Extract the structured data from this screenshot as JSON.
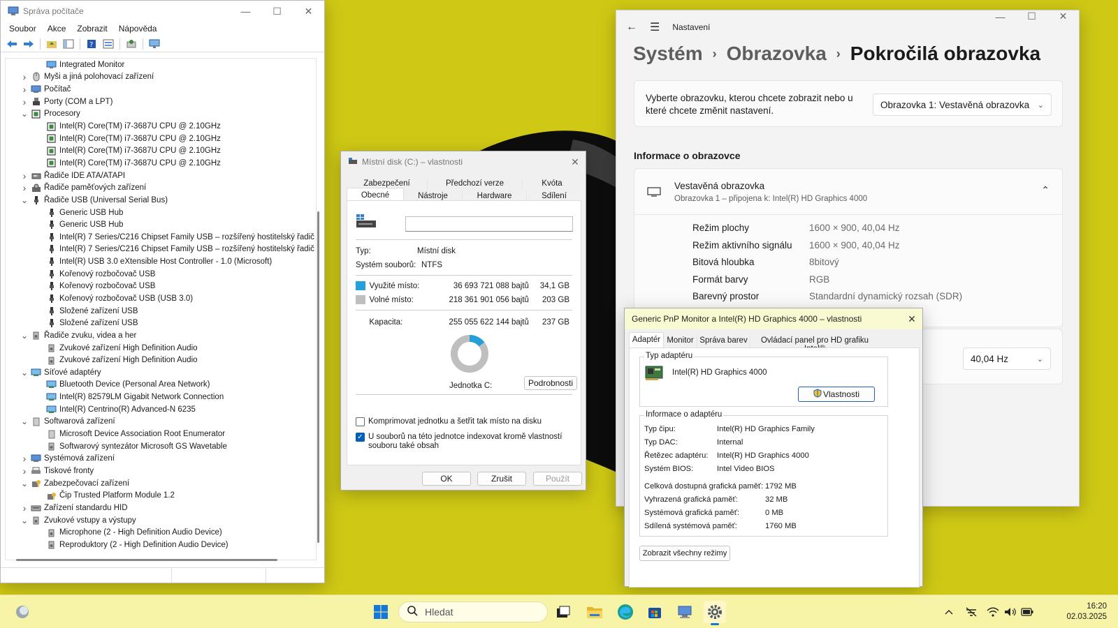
{
  "device_manager": {
    "title": "Správa počítače",
    "menu": [
      "Soubor",
      "Akce",
      "Zobrazit",
      "Nápověda"
    ],
    "tree": [
      {
        "label": "Integrated Monitor",
        "level": 2,
        "expander": "",
        "icon": "monitor-icon"
      },
      {
        "label": "Myši a jiná polohovací zařízení",
        "level": 1,
        "expander": "›",
        "icon": "mouse-icon"
      },
      {
        "label": "Počítač",
        "level": 1,
        "expander": "›",
        "icon": "computer-icon"
      },
      {
        "label": "Porty (COM a LPT)",
        "level": 1,
        "expander": "›",
        "icon": "port-icon"
      },
      {
        "label": "Procesory",
        "level": 1,
        "expander": "⌄",
        "icon": "processor-icon"
      },
      {
        "label": "Intel(R) Core(TM) i7-3687U CPU @ 2.10GHz",
        "level": 2,
        "expander": "",
        "icon": "processor-icon"
      },
      {
        "label": "Intel(R) Core(TM) i7-3687U CPU @ 2.10GHz",
        "level": 2,
        "expander": "",
        "icon": "processor-icon"
      },
      {
        "label": "Intel(R) Core(TM) i7-3687U CPU @ 2.10GHz",
        "level": 2,
        "expander": "",
        "icon": "processor-icon"
      },
      {
        "label": "Intel(R) Core(TM) i7-3687U CPU @ 2.10GHz",
        "level": 2,
        "expander": "",
        "icon": "processor-icon"
      },
      {
        "label": "Řadiče IDE ATA/ATAPI",
        "level": 1,
        "expander": "›",
        "icon": "disk-controller-icon"
      },
      {
        "label": "Řadiče paměťových zařízení",
        "level": 1,
        "expander": "›",
        "icon": "storage-controller-icon"
      },
      {
        "label": "Řadiče USB (Universal Serial Bus)",
        "level": 1,
        "expander": "⌄",
        "icon": "usb-icon"
      },
      {
        "label": "Generic USB Hub",
        "level": 2,
        "expander": "",
        "icon": "usb-icon"
      },
      {
        "label": "Generic USB Hub",
        "level": 2,
        "expander": "",
        "icon": "usb-icon"
      },
      {
        "label": "Intel(R) 7 Series/C216 Chipset Family USB – rozšířený hostitelský řadič",
        "level": 2,
        "expander": "",
        "icon": "usb-icon"
      },
      {
        "label": "Intel(R) 7 Series/C216 Chipset Family USB – rozšířený hostitelský řadič",
        "level": 2,
        "expander": "",
        "icon": "usb-icon"
      },
      {
        "label": "Intel(R) USB 3.0 eXtensible Host Controller - 1.0 (Microsoft)",
        "level": 2,
        "expander": "",
        "icon": "usb-icon"
      },
      {
        "label": "Kořenový rozbočovač USB",
        "level": 2,
        "expander": "",
        "icon": "usb-icon"
      },
      {
        "label": "Kořenový rozbočovač USB",
        "level": 2,
        "expander": "",
        "icon": "usb-icon"
      },
      {
        "label": "Kořenový rozbočovač USB (USB 3.0)",
        "level": 2,
        "expander": "",
        "icon": "usb-icon"
      },
      {
        "label": "Složené zařízení USB",
        "level": 2,
        "expander": "",
        "icon": "usb-icon"
      },
      {
        "label": "Složené zařízení USB",
        "level": 2,
        "expander": "",
        "icon": "usb-icon"
      },
      {
        "label": "Řadiče zvuku, videa a her",
        "level": 1,
        "expander": "⌄",
        "icon": "speaker-icon"
      },
      {
        "label": "Zvukové zařízení High Definition Audio",
        "level": 2,
        "expander": "",
        "icon": "speaker-icon"
      },
      {
        "label": "Zvukové zařízení High Definition Audio",
        "level": 2,
        "expander": "",
        "icon": "speaker-icon"
      },
      {
        "label": "Síťové adaptéry",
        "level": 1,
        "expander": "⌄",
        "icon": "network-icon"
      },
      {
        "label": "Bluetooth Device (Personal Area Network)",
        "level": 2,
        "expander": "",
        "icon": "network-icon"
      },
      {
        "label": "Intel(R) 82579LM Gigabit Network Connection",
        "level": 2,
        "expander": "",
        "icon": "network-icon"
      },
      {
        "label": "Intel(R) Centrino(R) Advanced-N 6235",
        "level": 2,
        "expander": "",
        "icon": "network-icon"
      },
      {
        "label": "Softwarová zařízení",
        "level": 1,
        "expander": "⌄",
        "icon": "software-device-icon"
      },
      {
        "label": "Microsoft Device Association Root Enumerator",
        "level": 2,
        "expander": "",
        "icon": "software-device-icon"
      },
      {
        "label": "Softwarový syntezátor Microsoft GS Wavetable",
        "level": 2,
        "expander": "",
        "icon": "speaker-icon"
      },
      {
        "label": "Systémová zařízení",
        "level": 1,
        "expander": "›",
        "icon": "system-device-icon"
      },
      {
        "label": "Tiskové fronty",
        "level": 1,
        "expander": "›",
        "icon": "printer-icon"
      },
      {
        "label": "Zabezpečovací zařízení",
        "level": 1,
        "expander": "⌄",
        "icon": "security-device-icon"
      },
      {
        "label": "Čip Trusted Platform Module 1.2",
        "level": 2,
        "expander": "",
        "icon": "security-device-icon"
      },
      {
        "label": "Zařízení standardu HID",
        "level": 1,
        "expander": "›",
        "icon": "hid-icon"
      },
      {
        "label": "Zvukové vstupy a výstupy",
        "level": 1,
        "expander": "⌄",
        "icon": "speaker-icon"
      },
      {
        "label": "Microphone (2 - High Definition Audio Device)",
        "level": 2,
        "expander": "",
        "icon": "speaker-icon"
      },
      {
        "label": "Reproduktory (2 - High Definition Audio Device)",
        "level": 2,
        "expander": "",
        "icon": "speaker-icon"
      }
    ]
  },
  "settings": {
    "app_name": "Nastavení",
    "breadcrumb": [
      "Systém",
      "Obrazovka",
      "Pokročilá obrazovka"
    ],
    "select_prompt": "Vyberte obrazovku, kterou chcete zobrazit nebo u které chcete změnit nastavení.",
    "display_dropdown": "Obrazovka 1: Vestavěná obrazovka",
    "section_title": "Informace o obrazovce",
    "display_name": "Vestavěná obrazovka",
    "display_subtitle": "Obrazovka 1 – připojena k: Intel(R) HD Graphics 4000",
    "info": [
      {
        "key": "Režim plochy",
        "value": "1600 × 900, 40,04 Hz"
      },
      {
        "key": "Režim aktivního signálu",
        "value": "1600 × 900, 40,04 Hz"
      },
      {
        "key": "Bitová hloubka",
        "value": "8bitový"
      },
      {
        "key": "Formát barvy",
        "value": "RGB"
      },
      {
        "key": "Barevný prostor",
        "value": "Standardní dynamický rozsah (SDR)"
      }
    ],
    "refresh_dropdown": "40,04 Hz"
  },
  "disk_properties": {
    "title": "Místní disk (C:) – vlastnosti",
    "tabs_row1": [
      "Zabezpečení",
      "Předchozí verze",
      "Kvóta"
    ],
    "tabs_row2": [
      "Obecné",
      "Nástroje",
      "Hardware",
      "Sdílení"
    ],
    "name_value": "",
    "type_label": "Typ:",
    "type_value": "Místní disk",
    "fs_label": "Systém souborů:",
    "fs_value": "NTFS",
    "used_label": "Využité místo:",
    "used_bytes": "36 693 721 088 bajtů",
    "used_size": "34,1 GB",
    "free_label": "Volné místo:",
    "free_bytes": "218 361 901 056 bajtů",
    "free_size": "203 GB",
    "cap_label": "Kapacita:",
    "cap_bytes": "255 055 622 144 bajtů",
    "cap_size": "237 GB",
    "used_fraction": 0.1439,
    "used_color": "#26a0da",
    "free_color": "#bfbfbf",
    "drive_label": "Jednotka C:",
    "details_button": "Podrobnosti",
    "compress_label": "Komprimovat jednotku a šetřit tak místo na disku",
    "compress_checked": false,
    "index_label": "U souborů na této jednotce indexovat kromě vlastností souboru také obsah",
    "index_checked": true,
    "ok": "OK",
    "cancel": "Zrušit",
    "apply": "Použít"
  },
  "monitor_properties": {
    "title": "Generic PnP Monitor a Intel(R) HD Graphics 4000 – vlastnosti",
    "tabs": [
      "Adaptér",
      "Monitor",
      "Správa barev",
      "Ovládací panel pro HD grafiku Intel®"
    ],
    "adapter_group": "Typ adaptéru",
    "adapter_name": "Intel(R) HD Graphics 4000",
    "properties_button": "Vlastnosti",
    "info_group": "Informace o adaptéru",
    "info": [
      {
        "key": "Typ čipu:",
        "value": "Intel(R) HD Graphics Family"
      },
      {
        "key": "Typ DAC:",
        "value": "Internal"
      },
      {
        "key": "Řetězec adaptéru:",
        "value": "Intel(R) HD Graphics 4000"
      },
      {
        "key": "Systém BIOS:",
        "value": "Intel Video BIOS"
      }
    ],
    "memory": [
      {
        "key": "Celková dostupná grafická paměť:",
        "value": "1792 MB"
      },
      {
        "key": "Vyhrazená grafická paměť:",
        "value": "32 MB"
      },
      {
        "key": "Systémová grafická paměť:",
        "value": "0 MB"
      },
      {
        "key": "Sdílená systémová paměť:",
        "value": "1760 MB"
      }
    ],
    "list_modes_button": "Zobrazit všechny režimy"
  },
  "taskbar": {
    "search_placeholder": "Hledat",
    "time": "16:20",
    "date": "02.03.2025"
  }
}
